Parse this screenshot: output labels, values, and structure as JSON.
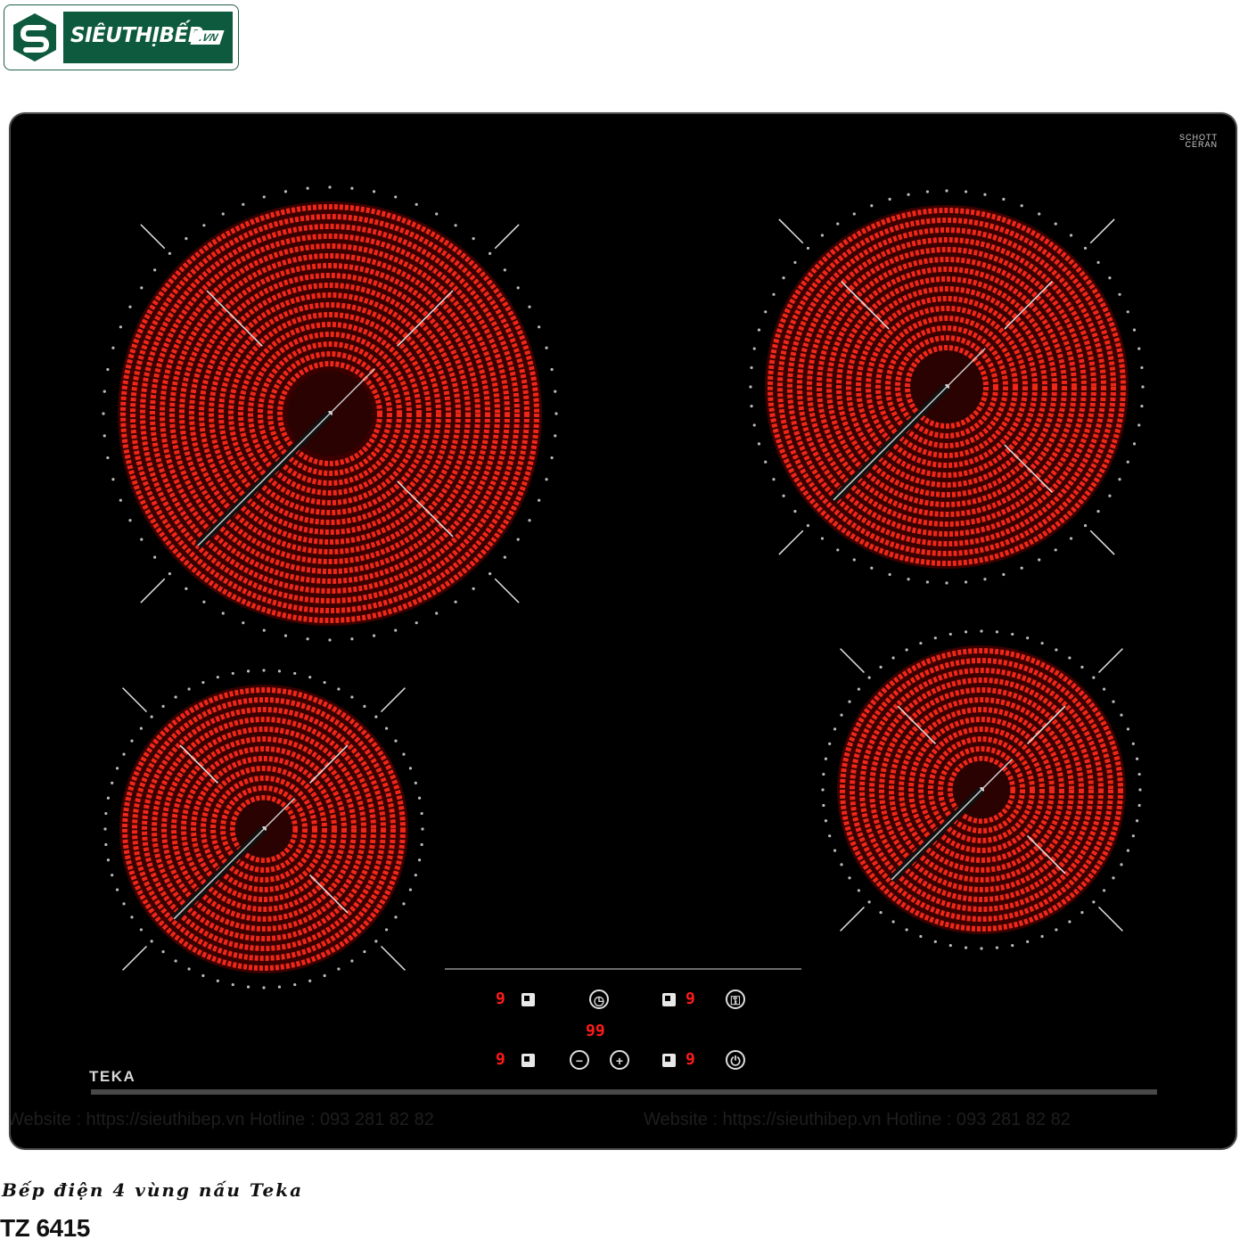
{
  "logo": {
    "brand": "SIÊUTHỊBẾP",
    "tld": ".VN"
  },
  "hob": {
    "glass_brand": [
      "SCHOTT",
      "CERAN"
    ],
    "maker": "TEKA",
    "watermarks": [
      "Website : https://sieuthibep.vn      Hotline : 093 281 82 82",
      "Website : https://sieuthibep.vn  Hotline : 093 281 82 82"
    ],
    "controls": {
      "zone_level_tl": "9",
      "zone_level_tr": "9",
      "zone_level_bl": "9",
      "zone_level_br": "9",
      "timer_display": "99",
      "timer_icon": "clock-icon",
      "minus_icon": "minus-icon",
      "plus_icon": "plus-icon",
      "lock_icon": "lock-icon",
      "power_icon": "power-icon"
    },
    "colors": {
      "glass": "#000000",
      "heating_element": "#ff2a1a",
      "display": "#ff1a1a"
    }
  },
  "caption": {
    "subtitle": "Bếp điện 4 vùng nấu Teka",
    "model": "TZ 6415"
  }
}
